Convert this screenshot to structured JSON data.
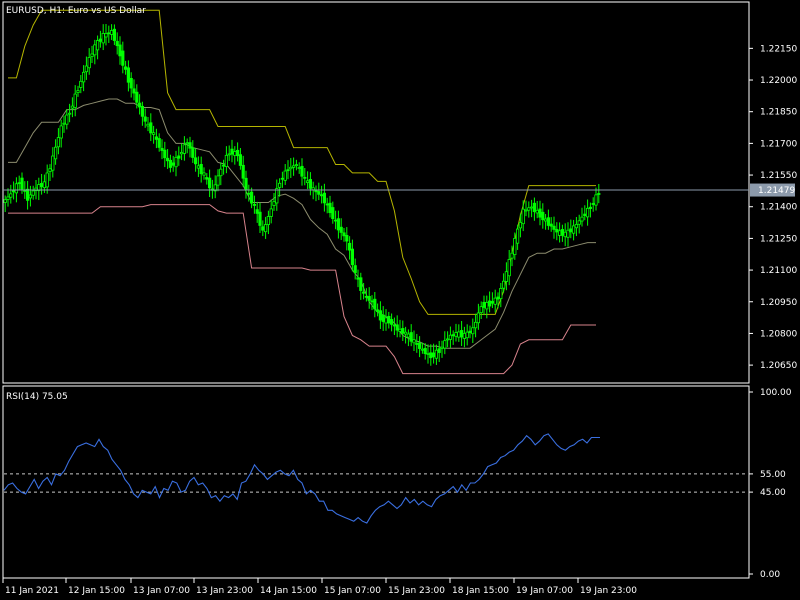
{
  "chart_data": [
    {
      "type": "candlestick",
      "title": "EURUSD, H1:  Euro vs US Dollar",
      "symbol": "EURUSD",
      "timeframe": "H1",
      "description": "Euro vs US Dollar",
      "y_ticks": [
        "1.22150",
        "1.22000",
        "1.21850",
        "1.21700",
        "1.21550",
        "1.21400",
        "1.21250",
        "1.21100",
        "1.20950",
        "1.20800",
        "1.20650"
      ],
      "ylim": [
        1.2057,
        1.2236
      ],
      "current_price": "1.21479",
      "x_ticks": [
        "11 Jan 2021",
        "12 Jan 15:00",
        "13 Jan 07:00",
        "13 Jan 23:00",
        "14 Jan 15:00",
        "15 Jan 07:00",
        "15 Jan 23:00",
        "18 Jan 15:00",
        "19 Jan 07:00",
        "19 Jan 23:00"
      ],
      "series": [
        {
          "name": "close",
          "color": "#00ff00",
          "values": [
            1.2146,
            1.2152,
            1.2144,
            1.2149,
            1.2151,
            1.2163,
            1.2178,
            1.2185,
            1.2196,
            1.2207,
            1.2216,
            1.2221,
            1.2223,
            1.2212,
            1.22,
            1.219,
            1.218,
            1.2174,
            1.2166,
            1.2159,
            1.2164,
            1.2171,
            1.216,
            1.2155,
            1.2147,
            1.2158,
            1.2166,
            1.2165,
            1.2148,
            1.214,
            1.2128,
            1.2139,
            1.2152,
            1.2158,
            1.216,
            1.2153,
            1.2148,
            1.2145,
            1.2138,
            1.213,
            1.2124,
            1.2108,
            1.2098,
            1.2095,
            1.2087,
            1.2086,
            1.2082,
            1.208,
            1.2076,
            1.2072,
            1.2069,
            1.2072,
            1.2078,
            1.208,
            1.2079,
            1.2082,
            1.2093,
            1.2094,
            1.2097,
            1.2109,
            1.2124,
            1.2138,
            1.214,
            1.2136,
            1.2132,
            1.2128,
            1.2127,
            1.213,
            1.2135,
            1.214,
            1.2147
          ]
        },
        {
          "name": "upper_band",
          "color": "#b5b500",
          "values": [
            1.2201,
            1.2201,
            1.2216,
            1.2226,
            1.2233,
            1.2233,
            1.2233,
            1.2233,
            1.2233,
            1.2233,
            1.2233,
            1.2233,
            1.2233,
            1.2233,
            1.2233,
            1.2233,
            1.2233,
            1.2233,
            1.2233,
            1.2194,
            1.2186,
            1.2186,
            1.2186,
            1.2186,
            1.2186,
            1.2178,
            1.2178,
            1.2178,
            1.2178,
            1.2178,
            1.2178,
            1.2178,
            1.2178,
            1.2178,
            1.2168,
            1.2168,
            1.2168,
            1.2168,
            1.2168,
            1.216,
            1.216,
            1.2156,
            1.2156,
            1.2156,
            1.2152,
            1.2152,
            1.2138,
            1.2116,
            1.2106,
            1.2095,
            1.2089,
            1.2089,
            1.2089,
            1.2089,
            1.2089,
            1.2089,
            1.2089,
            1.2089,
            1.2089,
            1.21,
            1.2118,
            1.2136,
            1.215,
            1.215,
            1.215,
            1.215,
            1.215,
            1.215,
            1.215,
            1.215,
            1.215
          ]
        },
        {
          "name": "middle_band",
          "color": "#8c8c6e",
          "values": [
            1.2161,
            1.2161,
            1.2168,
            1.2175,
            1.218,
            1.218,
            1.218,
            1.2186,
            1.2186,
            1.2188,
            1.2189,
            1.219,
            1.2191,
            1.2191,
            1.2189,
            1.2189,
            1.2187,
            1.2187,
            1.2186,
            1.2175,
            1.217,
            1.217,
            1.2168,
            1.2167,
            1.2166,
            1.2161,
            1.216,
            1.2155,
            1.215,
            1.2142,
            1.2142,
            1.2142,
            1.2145,
            1.2146,
            1.2144,
            1.2141,
            1.2134,
            1.213,
            1.2127,
            1.212,
            1.2117,
            1.211,
            1.2105,
            1.2095,
            1.209,
            1.2088,
            1.2085,
            1.2079,
            1.2077,
            1.2076,
            1.2074,
            1.2074,
            1.2073,
            1.2073,
            1.2073,
            1.2073,
            1.2076,
            1.2079,
            1.2082,
            1.209,
            1.21,
            1.2108,
            1.2116,
            1.2118,
            1.2118,
            1.212,
            1.212,
            1.2121,
            1.2122,
            1.2123,
            1.2123
          ]
        },
        {
          "name": "lower_band",
          "color": "#d8838c",
          "values": [
            1.2137,
            1.2137,
            1.2137,
            1.2137,
            1.2137,
            1.2137,
            1.2137,
            1.2137,
            1.2137,
            1.2137,
            1.2137,
            1.214,
            1.214,
            1.214,
            1.214,
            1.214,
            1.214,
            1.2141,
            1.2141,
            1.2141,
            1.2141,
            1.2141,
            1.2141,
            1.2141,
            1.2141,
            1.2138,
            1.2137,
            1.2137,
            1.2137,
            1.2111,
            1.2111,
            1.2111,
            1.2111,
            1.2111,
            1.2111,
            1.2111,
            1.211,
            1.211,
            1.211,
            1.211,
            1.2088,
            1.2079,
            1.2077,
            1.2074,
            1.2074,
            1.2074,
            1.2069,
            1.2061,
            1.2061,
            1.2061,
            1.2061,
            1.2061,
            1.2061,
            1.2061,
            1.2061,
            1.2061,
            1.2061,
            1.2061,
            1.2061,
            1.2061,
            1.2065,
            1.2075,
            1.2077,
            1.2077,
            1.2077,
            1.2077,
            1.2077,
            1.2084,
            1.2084,
            1.2084,
            1.2084
          ]
        }
      ],
      "colors": {
        "background": "#000000",
        "grid": "#ffffff",
        "candle": "#00ff00",
        "price_line": "#8c9aab",
        "price_tag_bg": "#8c9aab"
      }
    },
    {
      "type": "line",
      "title": "RSI(14) 75.05",
      "y_ticks": [
        "100.00",
        "55.00",
        "45.00",
        "0.00"
      ],
      "ylim": [
        0,
        100
      ],
      "levels": [
        55,
        45
      ],
      "series": [
        {
          "name": "RSI(14)",
          "color": "#3a6fe0",
          "values": [
            46,
            49,
            50,
            47,
            45,
            44,
            48,
            52,
            47,
            51,
            53,
            49,
            55,
            54,
            57,
            62,
            66,
            70,
            71,
            72,
            71,
            70,
            74,
            70,
            68,
            63,
            60,
            57,
            52,
            49,
            44,
            42,
            46,
            45,
            44,
            48,
            42,
            47,
            46,
            51,
            50,
            45,
            46,
            51,
            53,
            49,
            50,
            47,
            42,
            43,
            40,
            43,
            42,
            44,
            41,
            50,
            51,
            55,
            60,
            57,
            55,
            52,
            54,
            56,
            57,
            55,
            54,
            57,
            52,
            50,
            44,
            46,
            44,
            40,
            40,
            35,
            35,
            33,
            32,
            31,
            30,
            29,
            31,
            29,
            28,
            32,
            35,
            37,
            38,
            40,
            38,
            36,
            38,
            42,
            39,
            41,
            38,
            40,
            38,
            37,
            41,
            43,
            44,
            46,
            48,
            45,
            49,
            46,
            50,
            50,
            52,
            55,
            59,
            60,
            61,
            64,
            65,
            67,
            68,
            71,
            73,
            76,
            74,
            71,
            73,
            76,
            77,
            74,
            71,
            69,
            68,
            70,
            71,
            73,
            74,
            72,
            75,
            75,
            75
          ]
        }
      ]
    }
  ]
}
